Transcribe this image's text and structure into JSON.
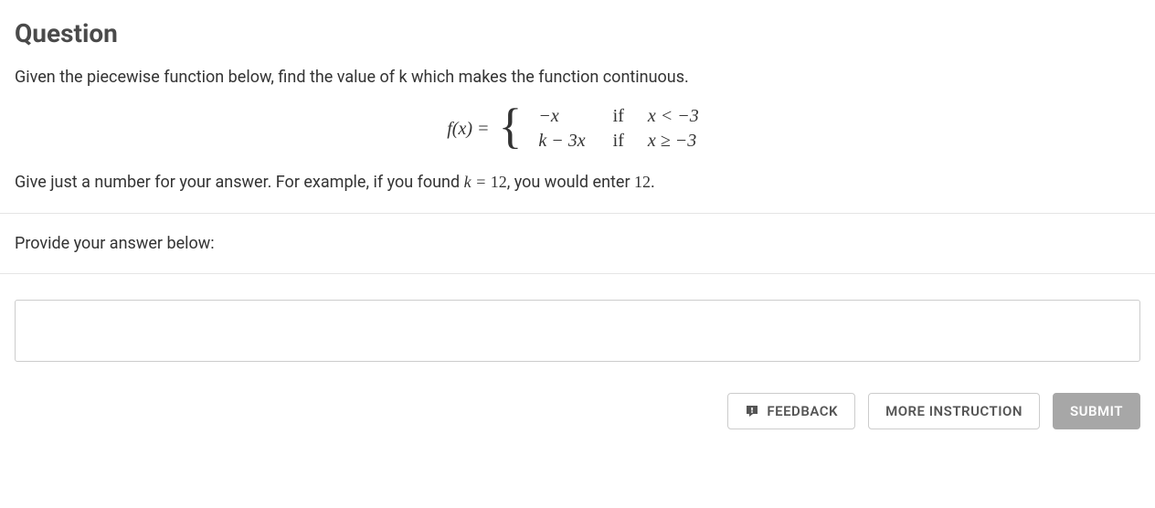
{
  "title": "Question",
  "prompt": "Given the piecewise function below, find the value of k which makes the function continuous.",
  "equation": {
    "lhs": "f(x) =",
    "pieces": [
      {
        "expr": "−x",
        "if": "if",
        "cond": "x < −3"
      },
      {
        "expr": "k − 3x",
        "if": "if",
        "cond": "x ≥ −3"
      }
    ]
  },
  "instruction_parts": {
    "p1": "Give just a number for your answer. For example, if you found ",
    "k_eq": "k = ",
    "twelve1": "12",
    "p2": ", you would enter ",
    "twelve2": "12",
    "p3": "."
  },
  "answer_label": "Provide your answer below:",
  "answer_value": "",
  "buttons": {
    "feedback": "FEEDBACK",
    "more": "MORE INSTRUCTION",
    "submit": "SUBMIT"
  }
}
